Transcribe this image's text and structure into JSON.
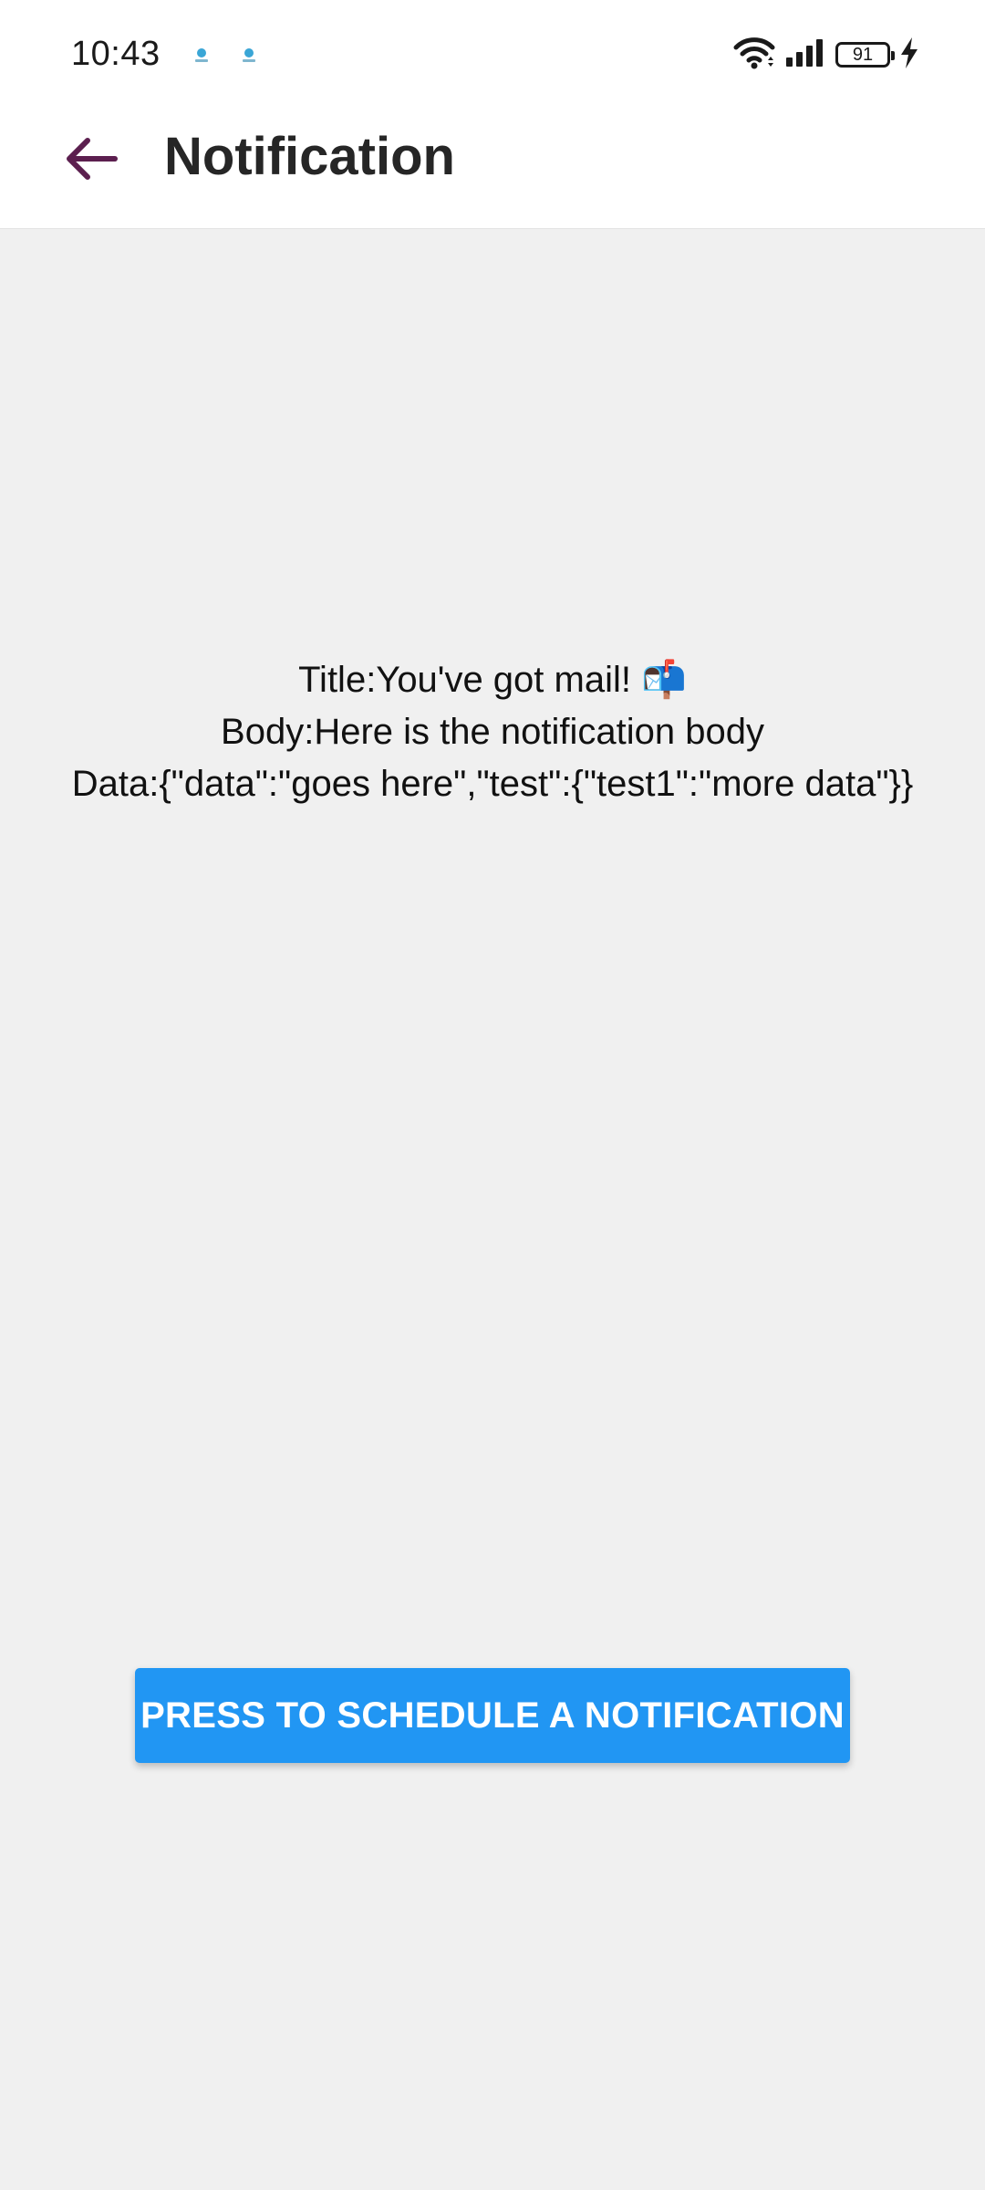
{
  "status_bar": {
    "time": "10:43",
    "battery_level": "91",
    "icons": [
      "app-notification-icon",
      "app-notification-icon",
      "wifi-icon",
      "cellular-signal-icon",
      "battery-icon",
      "charging-bolt-icon"
    ]
  },
  "app_bar": {
    "back_icon": "arrow-back-icon",
    "title": "Notification"
  },
  "notification": {
    "title_line": "Title:You've got mail! 📬",
    "body_line": "Body:Here is the notification body",
    "data_line": "Data:{\"data\":\"goes here\",\"test\":{\"test1\":\"more data\"}}"
  },
  "actions": {
    "schedule_label": "PRESS TO SCHEDULE A NOTIFICATION"
  },
  "colors": {
    "accent_button": "#2196f3",
    "back_arrow": "#5c1f4f",
    "background": "#f0f0f0",
    "app_bar": "#ffffff"
  }
}
